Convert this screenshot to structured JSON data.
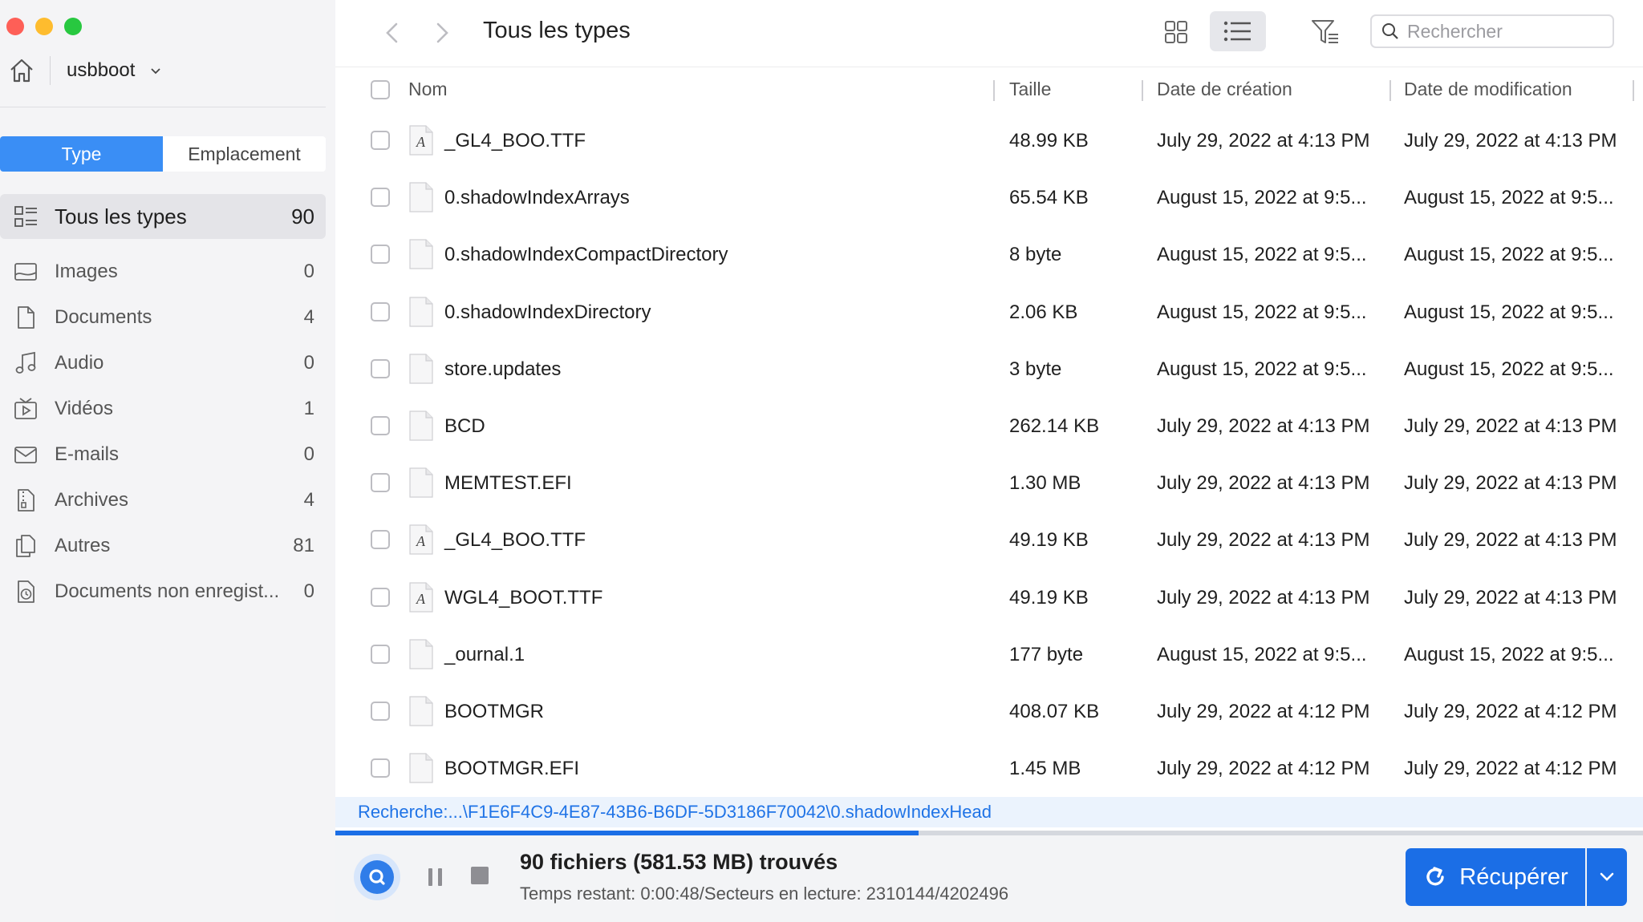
{
  "sidebar": {
    "device_name": "usbboot",
    "tabs": {
      "type": "Type",
      "location": "Emplacement"
    },
    "categories": [
      {
        "icon": "all-types-icon",
        "label": "Tous les types",
        "count": "90"
      },
      {
        "icon": "image-icon",
        "label": "Images",
        "count": "0"
      },
      {
        "icon": "document-icon",
        "label": "Documents",
        "count": "4"
      },
      {
        "icon": "music-note-icon",
        "label": "Audio",
        "count": "0"
      },
      {
        "icon": "video-icon",
        "label": "Vidéos",
        "count": "1"
      },
      {
        "icon": "mail-icon",
        "label": "E-mails",
        "count": "0"
      },
      {
        "icon": "archive-icon",
        "label": "Archives",
        "count": "4"
      },
      {
        "icon": "copy-icon",
        "label": "Autres",
        "count": "81"
      },
      {
        "icon": "unsaved-document-icon",
        "label": "Documents non enregist...",
        "count": "0"
      }
    ]
  },
  "toolbar": {
    "title": "Tous les types",
    "search_placeholder": "Rechercher"
  },
  "table": {
    "headers": {
      "name": "Nom",
      "size": "Taille",
      "created": "Date de création",
      "modified": "Date de modification"
    },
    "rows": [
      {
        "type": "font",
        "name": "_GL4_BOO.TTF",
        "size": "48.99 KB",
        "created": "July 29, 2022 at 4:13 PM",
        "modified": "July 29, 2022 at 4:13 PM"
      },
      {
        "type": "file",
        "name": "0.shadowIndexArrays",
        "size": "65.54 KB",
        "created": "August 15, 2022 at 9:5...",
        "modified": "August 15, 2022 at 9:5..."
      },
      {
        "type": "file",
        "name": "0.shadowIndexCompactDirectory",
        "size": "8 byte",
        "created": "August 15, 2022 at 9:5...",
        "modified": "August 15, 2022 at 9:5..."
      },
      {
        "type": "file",
        "name": "0.shadowIndexDirectory",
        "size": "2.06 KB",
        "created": "August 15, 2022 at 9:5...",
        "modified": "August 15, 2022 at 9:5..."
      },
      {
        "type": "file",
        "name": "store.updates",
        "size": "3 byte",
        "created": "August 15, 2022 at 9:5...",
        "modified": "August 15, 2022 at 9:5..."
      },
      {
        "type": "file",
        "name": "BCD",
        "size": "262.14 KB",
        "created": "July 29, 2022 at 4:13 PM",
        "modified": "July 29, 2022 at 4:13 PM"
      },
      {
        "type": "file",
        "name": "MEMTEST.EFI",
        "size": "1.30 MB",
        "created": "July 29, 2022 at 4:13 PM",
        "modified": "July 29, 2022 at 4:13 PM"
      },
      {
        "type": "font",
        "name": "_GL4_BOO.TTF",
        "size": "49.19 KB",
        "created": "July 29, 2022 at 4:13 PM",
        "modified": "July 29, 2022 at 4:13 PM"
      },
      {
        "type": "font",
        "name": "WGL4_BOOT.TTF",
        "size": "49.19 KB",
        "created": "July 29, 2022 at 4:13 PM",
        "modified": "July 29, 2022 at 4:13 PM"
      },
      {
        "type": "file",
        "name": "_ournal.1",
        "size": "177 byte",
        "created": "August 15, 2022 at 9:5...",
        "modified": "August 15, 2022 at 9:5..."
      },
      {
        "type": "file",
        "name": "BOOTMGR",
        "size": "408.07 KB",
        "created": "July 29, 2022 at 4:12 PM",
        "modified": "July 29, 2022 at 4:12 PM"
      },
      {
        "type": "file",
        "name": "BOOTMGR.EFI",
        "size": "1.45 MB",
        "created": "July 29, 2022 at 4:12 PM",
        "modified": "July 29, 2022 at 4:12 PM"
      }
    ]
  },
  "scan": {
    "path": "Recherche:...\\F1E6F4C9-4E87-43B6-B6DF-5D3186F70042\\0.shadowIndexHead",
    "progress_percent": 44.6,
    "found": "90 fichiers (581.53 MB) trouvés",
    "remaining": "Temps restant: 0:00:48/Secteurs en lecture: 2310144/4202496"
  },
  "actions": {
    "recover_label": "Récupérer"
  },
  "colors": {
    "accent": "#1b6ee6",
    "sidebar_bg": "#f4f4f6",
    "selected_tab": "#3a8ef5"
  }
}
